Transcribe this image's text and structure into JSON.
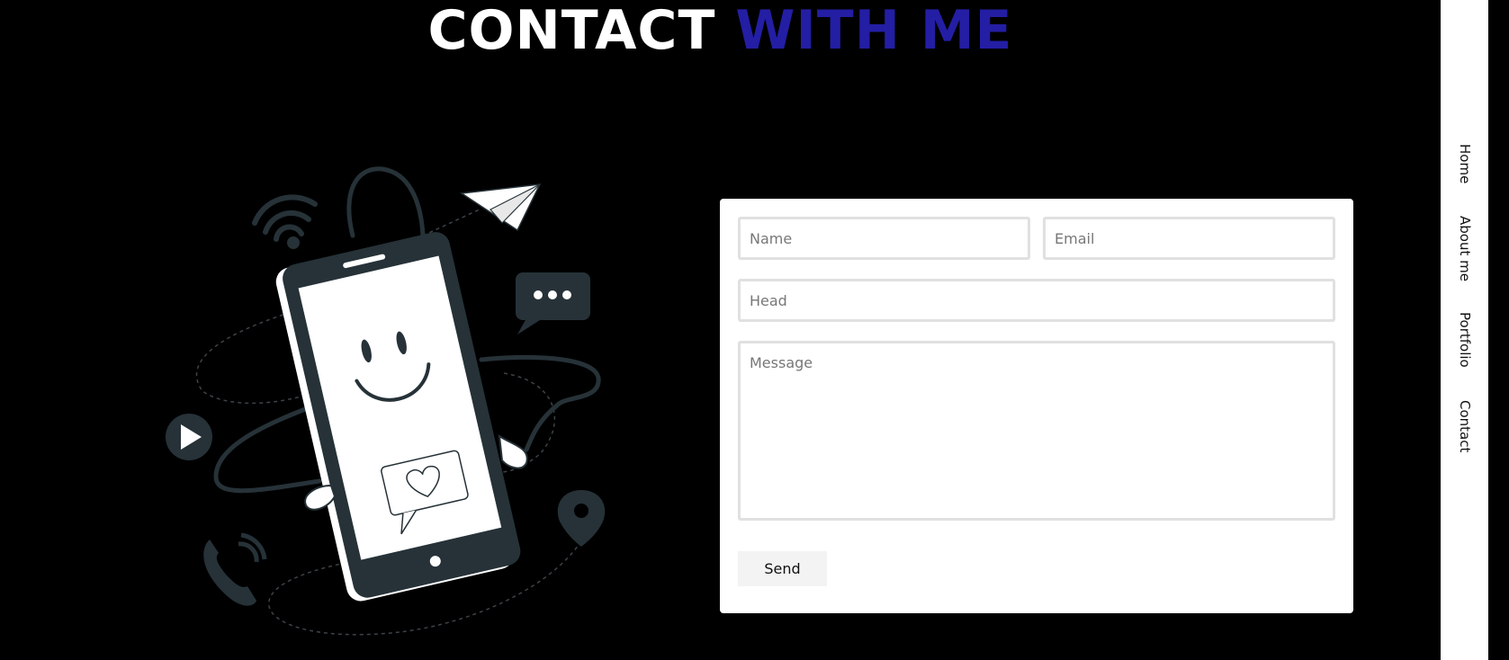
{
  "header": {
    "title_part1": "CONTACT",
    "title_part2": "WITH ME"
  },
  "colors": {
    "background": "#000000",
    "accent": "#231ea3",
    "illustration": "#263238"
  },
  "form": {
    "name_placeholder": "Name",
    "email_placeholder": "Email",
    "head_placeholder": "Head",
    "message_placeholder": "Message",
    "send_label": "Send"
  },
  "nav": {
    "items": [
      {
        "label": "Home"
      },
      {
        "label": "About me"
      },
      {
        "label": "Portfolio"
      },
      {
        "label": "Contact"
      }
    ]
  },
  "illustration": {
    "icons": [
      "phone-smiley",
      "wifi-icon",
      "paper-plane-icon",
      "chat-bubble-icon",
      "play-icon",
      "call-icon",
      "location-pin-icon",
      "heart-message-icon",
      "earbuds"
    ]
  }
}
